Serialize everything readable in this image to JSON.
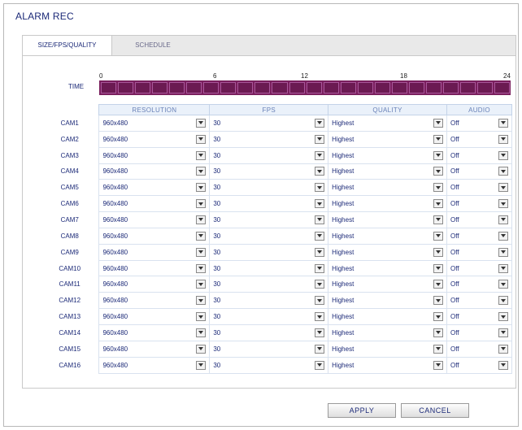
{
  "page": {
    "title": "ALARM REC"
  },
  "tabs": [
    {
      "label": "SIZE/FPS/QUALITY",
      "active": true
    },
    {
      "label": "SCHEDULE",
      "active": false
    }
  ],
  "timeline": {
    "label": "TIME",
    "ticks": [
      "0",
      "6",
      "12",
      "18",
      "24"
    ],
    "segments": 24,
    "bar_color": "#7a1f5e"
  },
  "table": {
    "headers": [
      "RESOLUTION",
      "FPS",
      "QUALITY",
      "AUDIO"
    ],
    "rows": [
      {
        "cam": "CAM1",
        "resolution": "960x480",
        "fps": "30",
        "quality": "Highest",
        "audio": "Off"
      },
      {
        "cam": "CAM2",
        "resolution": "960x480",
        "fps": "30",
        "quality": "Highest",
        "audio": "Off"
      },
      {
        "cam": "CAM3",
        "resolution": "960x480",
        "fps": "30",
        "quality": "Highest",
        "audio": "Off"
      },
      {
        "cam": "CAM4",
        "resolution": "960x480",
        "fps": "30",
        "quality": "Highest",
        "audio": "Off"
      },
      {
        "cam": "CAM5",
        "resolution": "960x480",
        "fps": "30",
        "quality": "Highest",
        "audio": "Off"
      },
      {
        "cam": "CAM6",
        "resolution": "960x480",
        "fps": "30",
        "quality": "Highest",
        "audio": "Off"
      },
      {
        "cam": "CAM7",
        "resolution": "960x480",
        "fps": "30",
        "quality": "Highest",
        "audio": "Off"
      },
      {
        "cam": "CAM8",
        "resolution": "960x480",
        "fps": "30",
        "quality": "Highest",
        "audio": "Off"
      },
      {
        "cam": "CAM9",
        "resolution": "960x480",
        "fps": "30",
        "quality": "Highest",
        "audio": "Off"
      },
      {
        "cam": "CAM10",
        "resolution": "960x480",
        "fps": "30",
        "quality": "Highest",
        "audio": "Off"
      },
      {
        "cam": "CAM11",
        "resolution": "960x480",
        "fps": "30",
        "quality": "Highest",
        "audio": "Off"
      },
      {
        "cam": "CAM12",
        "resolution": "960x480",
        "fps": "30",
        "quality": "Highest",
        "audio": "Off"
      },
      {
        "cam": "CAM13",
        "resolution": "960x480",
        "fps": "30",
        "quality": "Highest",
        "audio": "Off"
      },
      {
        "cam": "CAM14",
        "resolution": "960x480",
        "fps": "30",
        "quality": "Highest",
        "audio": "Off"
      },
      {
        "cam": "CAM15",
        "resolution": "960x480",
        "fps": "30",
        "quality": "Highest",
        "audio": "Off"
      },
      {
        "cam": "CAM16",
        "resolution": "960x480",
        "fps": "30",
        "quality": "Highest",
        "audio": "Off"
      }
    ]
  },
  "buttons": {
    "apply": "APPLY",
    "cancel": "CANCEL"
  },
  "colors": {
    "accent": "#1c2a78",
    "header_bg": "#eaf1fa",
    "schedule": "#7a1f5e"
  }
}
